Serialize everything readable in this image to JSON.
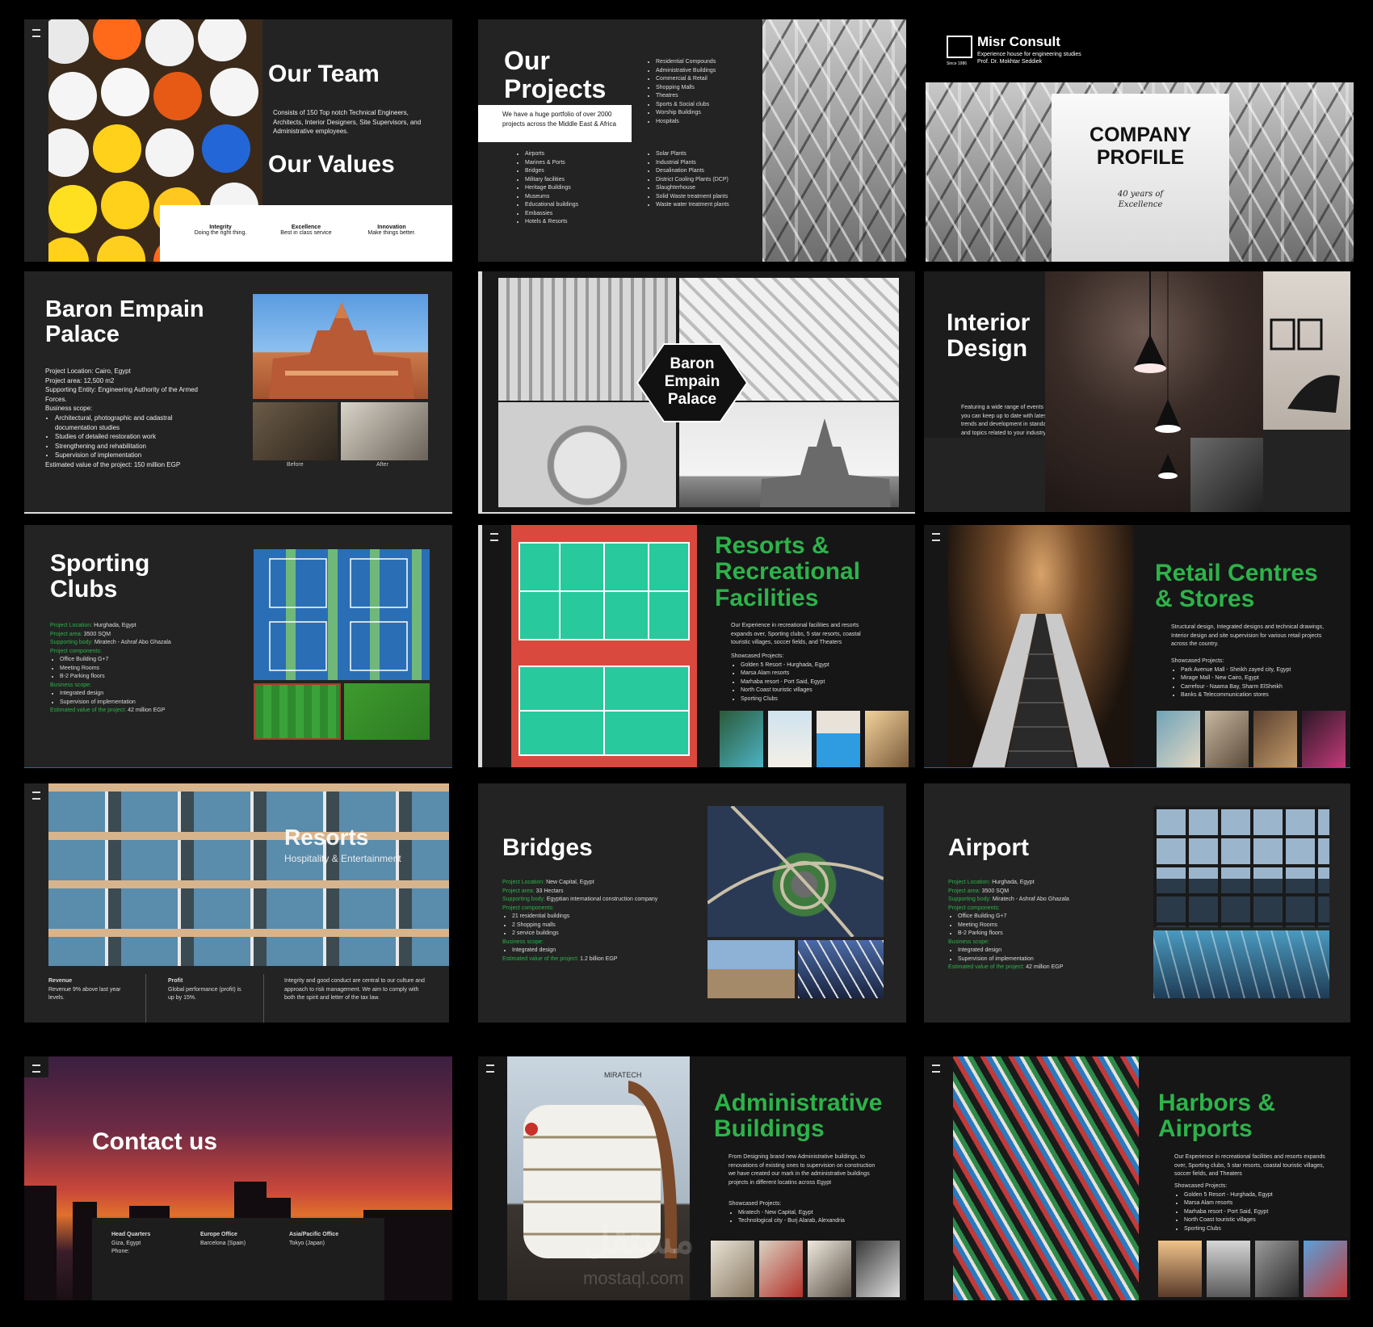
{
  "team": {
    "title": "Our Team",
    "desc": "Consists of 150 Top notch Technical Engineers, Architects, Interior Designers, Site Supervisors, and Administrative employees.",
    "values_title": "Our Values",
    "values": [
      {
        "name": "Integrity",
        "desc": "Doing the right thing."
      },
      {
        "name": "Excellence",
        "desc": "Best in class service"
      },
      {
        "name": "Innovation",
        "desc": "Make things better."
      }
    ]
  },
  "projects": {
    "title_line1": "Our",
    "title_line2": "Projects",
    "desc": "We have a huge portfolio of over 2000 projects across the Middle East & Africa",
    "list_a": [
      "Residential Compounds",
      "Administrative Buildings",
      "Commercial & Retail",
      "Shopping Malls",
      "Theatres",
      "Sports & Social clubs",
      "Worship Buildings",
      "Hospitals"
    ],
    "list_b": [
      "Airports",
      "Marines & Ports",
      "Bridges",
      "Military facilities",
      "Heritage Buildings",
      "Museums",
      "Educational buildings",
      "Embassies",
      "Hotels & Resorts"
    ],
    "list_c": [
      "Solar Plants",
      "Industrial Plants",
      "Desalination Plants",
      "District Cooling Plants (DCP)",
      "Slaughterhouse",
      "Solid Waste treatment plants",
      "Waste water treatment plants"
    ]
  },
  "cover": {
    "brand": "Misr Consult",
    "tagline": "Experience house for engineering studies",
    "founder": "Prof. Dr. Mokhtar Seddiek",
    "since": "Since 1986",
    "title_line1": "COMPANY",
    "title_line2": "PROFILE",
    "script_line1": "40 years of",
    "script_line2": "Excellence"
  },
  "baron": {
    "title_line1": "Baron Empain",
    "title_line2": "Palace",
    "location": "Project Location: Cairo, Egypt",
    "area": "Project area: 12,500 m2",
    "entity": "Supporting Entity: Engineering Authority of the Armed Forces.",
    "scope_label": "Business scope:",
    "scope": [
      "Architectural, photographic and cadastral documentation studies",
      "Studies of detailed restoration work",
      "Strengthening and rehabilitation",
      "Supervision of implementation"
    ],
    "value": "Estimated value of the project: 150 million EGP",
    "before": "Before",
    "after": "After"
  },
  "baron2": {
    "line1": "Baron",
    "line2": "Empain",
    "line3": "Palace"
  },
  "interior": {
    "title_line1": "Interior",
    "title_line2": "Design",
    "desc": "Featuring a wide range of events so you can keep up to date with latest trends and development in standards and topics related to your industry."
  },
  "sporting": {
    "title_line1": "Sporting",
    "title_line2": "Clubs",
    "loc_label": "Project Location:",
    "loc": "Hurghada, Egypt",
    "area_label": "Project area:",
    "area": "3500 SQM",
    "body_label": "Supporting body:",
    "body": "Miratech - Ashraf Abo Ghazala",
    "comp_label": "Project components:",
    "components": [
      "Office Building G+7",
      "Meeting Rooms",
      "B-2 Parking floors"
    ],
    "scope_label": "Business scope:",
    "scope": [
      "Integrated design",
      "Supervision of implementation"
    ],
    "value_label": "Estimated value of the project:",
    "value": "42 million EGP"
  },
  "resorts_rec": {
    "title_line1": "Resorts &",
    "title_line2": "Recreational",
    "title_line3": "Facilities",
    "desc": "Our Experience in recreational facilities and resorts expands over, Sporting clubs, 5 star resorts, coastal touristic villages, soccer fields, and Theaters",
    "show_label": "Showcased Projects:",
    "projects": [
      "Golden 5 Resort - Hurghada, Egypt",
      "Marsa Alam resorts",
      "Marhaba resort - Port Said, Egypt",
      "North Coast touristic villages",
      "Sporting Clubs"
    ]
  },
  "retail": {
    "title_line1": "Retail Centres",
    "title_line2": "& Stores",
    "desc": "Structural design, Integrated designs and technical drawings, Interior design and site supervision for various retail projects across the country.",
    "show_label": "Showcased Projects:",
    "projects": [
      "Park Avenue Mall - Sheikh zayed city, Egypt",
      "Mirage Mall - New Cairo, Egypt",
      "Carrefour - Naama Bay, Sharm ElSheikh",
      "Banks & Telecommunication stores"
    ]
  },
  "resorts_hosp": {
    "title": "Resorts",
    "subtitle": "Hospitality & Entertainment",
    "rev_label": "Revenue",
    "rev": "Revenue 9% above last year levels.",
    "profit_label": "Profit",
    "profit": "Global performance (profit) is up by 15%.",
    "integrity": "Integrity and good conduct are central to our culture and approach to risk management. We aim to comply with both the spirit and letter of the tax law."
  },
  "bridges": {
    "title": "Bridges",
    "loc_label": "Project Location:",
    "loc": "New Capital, Egypt",
    "area_label": "Project area:",
    "area": "33 Hectars",
    "body_label": "Supporting body:",
    "body": "Egyptian international construction company",
    "comp_label": "Project components:",
    "components": [
      "21 residential buildings",
      "2 Shopping malls",
      "2 service buildings"
    ],
    "scope_label": "Business scope:",
    "scope": [
      "Integrated design"
    ],
    "value_label": "Estimated value of the project:",
    "value": "1.2 billion EGP"
  },
  "airport": {
    "title": "Airport",
    "loc_label": "Project Location:",
    "loc": "Hurghada, Egypt",
    "area_label": "Project area:",
    "area": "3500 SQM",
    "body_label": "Supporting body:",
    "body": "Miratech - Ashraf Abo Ghazala",
    "comp_label": "Project components:",
    "components": [
      "Office Building G+7",
      "Meeting Rooms",
      "B-2 Parking floors"
    ],
    "scope_label": "Business scope:",
    "scope": [
      "Integrated design",
      "Supervision of implementation"
    ],
    "value_label": "Estimated value of the project:",
    "value": "42 million EGP"
  },
  "contact": {
    "title": "Contact us",
    "hq_label": "Head Quarters",
    "hq_city": "Giza, Egypt",
    "hq_phone": "Phone:",
    "eu_label": "Europe Office",
    "eu_city": "Barcelona (Spain)",
    "asia_label": "Asia/Pacific Office",
    "asia_city": "Tokyo (Japan)"
  },
  "admin": {
    "title_line1": "Administrative",
    "title_line2": "Buildings",
    "desc": "From Designing brand new Administrative buildings, to renovations of existing ones to supervision on construction we have created our mark in the administrative buildings projects in different locatins across Egypt",
    "show_label": "Showcased Projects:",
    "projects": [
      "Miratech - New Capital, Egypt",
      "Technological city - Burj Alarab, Alexandria"
    ],
    "sign": "MIRATECH"
  },
  "harbors": {
    "title_line1": "Harbors &",
    "title_line2": "Airports",
    "desc": "Our Experience in recreational facilities and resorts expands over, Sporting clubs, 5 star resorts, coastal touristic villages, soccer fields, and Theaters",
    "show_label": "Showcased Projects:",
    "projects": [
      "Golden 5 Resort - Hurghada, Egypt",
      "Marsa Alam resorts",
      "Marhaba resort - Port Said, Egypt",
      "North Coast touristic villages",
      "Sporting Clubs"
    ]
  },
  "watermark": {
    "arabic": "مستقل",
    "latin": "mostaql.com"
  },
  "colors": {
    "accent_green": "#2db34a",
    "slide_bg": "#232323",
    "page_bg": "#000000"
  }
}
